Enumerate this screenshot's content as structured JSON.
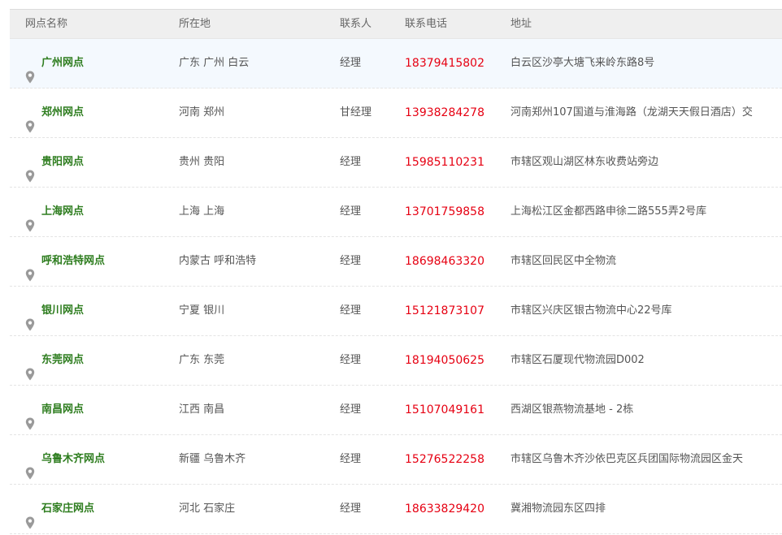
{
  "headers": {
    "name": "网点名称",
    "location": "所在地",
    "contact": "联系人",
    "phone": "联系电话",
    "address": "地址"
  },
  "rows": [
    {
      "name": "广州网点",
      "location": "广东 广州 白云",
      "contact": "经理",
      "phone": "18379415802",
      "address": "白云区沙亭大塘飞来岭东路8号"
    },
    {
      "name": "郑州网点",
      "location": "河南 郑州",
      "contact": "甘经理",
      "phone": "13938284278",
      "address": "河南郑州107国道与淮海路（龙湖天天假日酒店）交"
    },
    {
      "name": "贵阳网点",
      "location": "贵州 贵阳",
      "contact": "经理",
      "phone": "15985110231",
      "address": "市辖区观山湖区林东收费站旁边"
    },
    {
      "name": "上海网点",
      "location": "上海 上海",
      "contact": "经理",
      "phone": "13701759858",
      "address": "上海松江区金都西路申徐二路555弄2号库"
    },
    {
      "name": "呼和浩特网点",
      "location": "内蒙古 呼和浩特",
      "contact": "经理",
      "phone": "18698463320",
      "address": "市辖区回民区中全物流"
    },
    {
      "name": "银川网点",
      "location": "宁夏 银川",
      "contact": "经理",
      "phone": "15121873107",
      "address": "市辖区兴庆区银古物流中心22号库"
    },
    {
      "name": "东莞网点",
      "location": "广东 东莞",
      "contact": "经理",
      "phone": "18194050625",
      "address": "市辖区石厦现代物流园D002"
    },
    {
      "name": "南昌网点",
      "location": "江西 南昌",
      "contact": "经理",
      "phone": "15107049161",
      "address": "西湖区银燕物流基地 - 2栋"
    },
    {
      "name": "乌鲁木齐网点",
      "location": "新疆 乌鲁木齐",
      "contact": "经理",
      "phone": "15276522258",
      "address": "市辖区乌鲁木齐沙依巴克区兵团国际物流园区金天"
    },
    {
      "name": "石家庄网点",
      "location": "河北 石家庄",
      "contact": "经理",
      "phone": "18633829420",
      "address": "冀湘物流园东区四排"
    }
  ],
  "icons": {
    "row_icon": "location-pin-icon"
  },
  "colors": {
    "name": "#2e7d1f",
    "phone": "#e60012",
    "header_bg": "#efefef",
    "highlight_bg": "#f4f9fe"
  }
}
